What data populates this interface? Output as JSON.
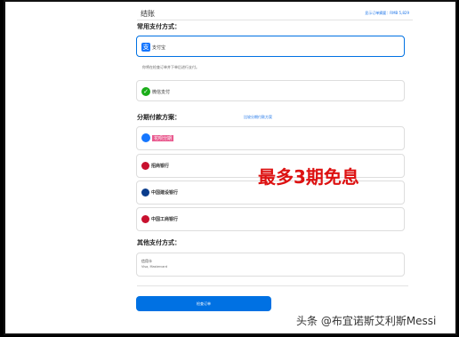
{
  "header": {
    "title": "结账",
    "summary": "显示订单摘要：RMB 5,829"
  },
  "common": {
    "label": "常用支付方式："
  },
  "alipay": {
    "name": "支付宝",
    "note": "你将在检查订单并下单后进行支付。"
  },
  "wechat": {
    "name": "微信支付"
  },
  "installments": {
    "label": "分期付款方案：",
    "compare": "比较分期付款方案",
    "huabei": "花呗分期"
  },
  "banks": {
    "cmb": "招商银行",
    "ccb": "中国建设银行",
    "icbc": "中国工商银行"
  },
  "other": {
    "label": "其他支付方式：",
    "card_title": "信用卡",
    "card_sub": "Visa, Mastercard"
  },
  "submit": {
    "label": "检查订单"
  },
  "overlay": {
    "text": "最多3期免息"
  },
  "watermark": {
    "text": "头条 @布宜诺斯艾利斯Messi"
  },
  "colors": {
    "accent": "#0071e3",
    "overlay": "#dd1111"
  }
}
